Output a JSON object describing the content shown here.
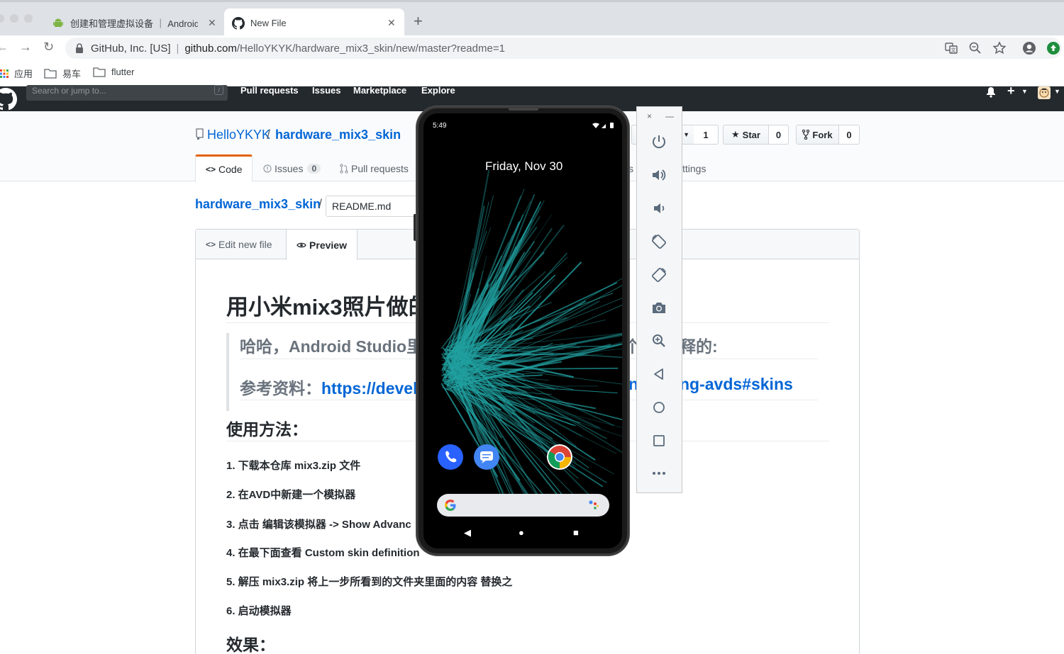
{
  "browser": {
    "tabs": [
      {
        "label": "创建和管理虚拟设备 ｜ Android"
      },
      {
        "label": "New File"
      }
    ],
    "origin": "GitHub, Inc. [US]",
    "url_host": "github.com",
    "url_path": "/HelloYKYK/hardware_mix3_skin/new/master?readme=1",
    "bookmarks": [
      {
        "label": "应用"
      },
      {
        "label": "易车"
      },
      {
        "label": "flutter"
      }
    ]
  },
  "github": {
    "search_placeholder": "Search or jump to...",
    "search_shortcut": "/",
    "nav": [
      "Pull requests",
      "Issues",
      "Marketplace",
      "Explore"
    ],
    "owner": "HelloYKYK",
    "repo": "hardware_mix3_skin",
    "watch_count": "1",
    "star_label": "Star",
    "star_count": "0",
    "fork_label": "Fork",
    "fork_count": "0",
    "tabs": {
      "code": "Code",
      "issues": "Issues",
      "issues_count": "0",
      "pulls": "Pull requests",
      "settings_tail": "ttings",
      "hidden_tail": "s"
    },
    "breadcrumb_repo": "hardware_mix3_skin",
    "filename": "README.md",
    "editor_tabs": {
      "edit": "Edit new file",
      "preview": "Preview"
    }
  },
  "preview": {
    "h1": "用小米mix3照片做的",
    "bq_line1": "哈哈，Android Studio里的",
    "bq_tail1": "释的:",
    "bq_line2_prefix": "参考资料：",
    "bq_line2_link": "https://devel",
    "bq_tail2": "n",
    "bq_tail2_right": "ng-avds#skins",
    "bq_glyph": "个",
    "h2": "使用方法：",
    "steps": [
      "1. 下载本仓库 mix3.zip 文件",
      "2. 在AVD中新建一个模拟器",
      "3. 点击 编辑该模拟器 -> Show Advanc",
      "4. 在最下面查看 Custom skin definition",
      "5. 解压 mix3.zip 将上一步所看到的文件夹里面的内容 替换之",
      "6. 启动模拟器"
    ],
    "h2b": "效果："
  },
  "emulator": {
    "time": "5:49",
    "date": "Friday, Nov 30",
    "toolbar_close": "×",
    "toolbar_min": "—",
    "accent": "#21a0a0"
  }
}
